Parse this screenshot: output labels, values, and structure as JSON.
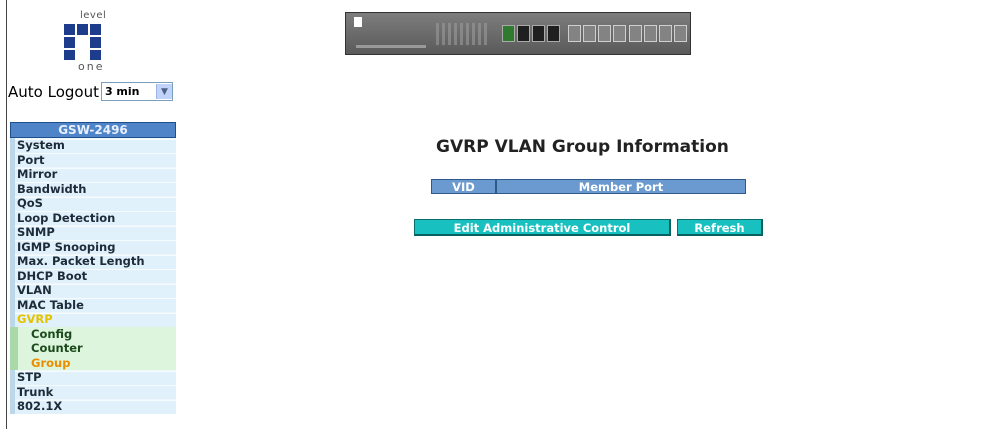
{
  "logo": {
    "top_text": "level",
    "bottom_text": "one"
  },
  "auto_logout": {
    "label": "Auto Logout",
    "value": "3 min"
  },
  "sidebar": {
    "header": "GSW-2496",
    "items": [
      {
        "label": "System"
      },
      {
        "label": "Port"
      },
      {
        "label": "Mirror"
      },
      {
        "label": "Bandwidth"
      },
      {
        "label": "QoS"
      },
      {
        "label": "Loop Detection"
      },
      {
        "label": "SNMP"
      },
      {
        "label": "IGMP Snooping"
      },
      {
        "label": "Max. Packet Length"
      },
      {
        "label": "DHCP Boot"
      },
      {
        "label": "VLAN"
      },
      {
        "label": "MAC Table"
      },
      {
        "label": "GVRP"
      },
      {
        "label": "Config"
      },
      {
        "label": "Counter"
      },
      {
        "label": "Group"
      },
      {
        "label": "STP"
      },
      {
        "label": "Trunk"
      },
      {
        "label": "802.1X"
      }
    ]
  },
  "main": {
    "title": "GVRP VLAN Group Information",
    "table_headers": [
      "VID",
      "Member Port"
    ],
    "buttons": {
      "edit": "Edit Administrative Control",
      "refresh": "Refresh"
    }
  },
  "colors": {
    "sidebar_header": "#4f85c8",
    "table_header": "#6b9ad0",
    "button": "#19c0c0",
    "active_item": "#e3c300",
    "selected_subitem": "#ea8e00"
  }
}
